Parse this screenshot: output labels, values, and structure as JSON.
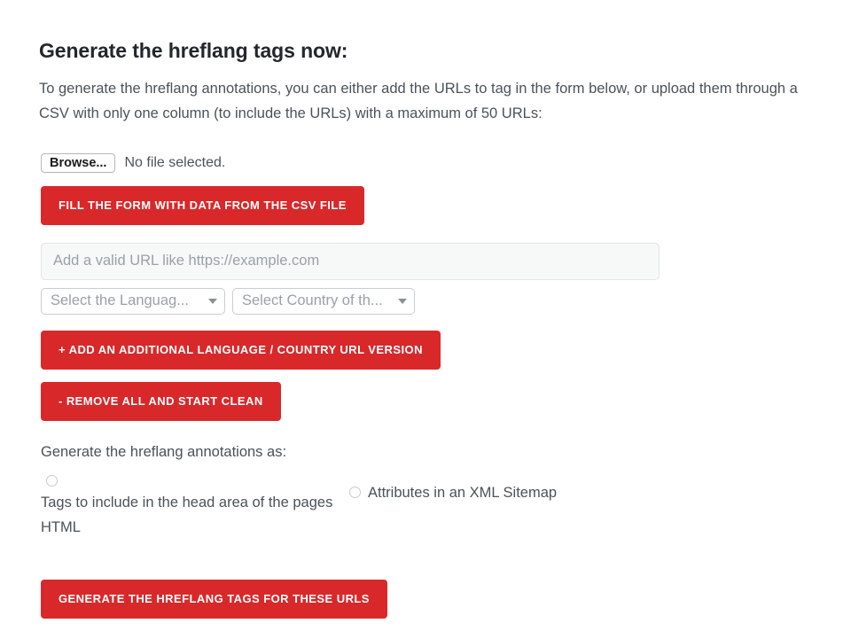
{
  "page": {
    "title": "Generate the hreflang tags now:",
    "intro": "To generate the hreflang annotations, you can either add the URLs to tag in the form below, or upload them through a CSV with only one column (to include the URLs) with a maximum of 50 URLs:",
    "accent_color": "#d8282a",
    "text_color": "#4b525a",
    "heading_color": "#23272c",
    "background": "#ffffff"
  },
  "file_upload": {
    "browse_label": "Browse...",
    "status_text": "No file selected.",
    "fill_form_button": "FILL THE FORM WITH DATA FROM THE CSV FILE"
  },
  "url_entry": {
    "url_placeholder": "Add a valid URL like https://example.com",
    "url_value": "",
    "language_select": {
      "selected": "Select the Languag...",
      "caret_icon": "chevron-down-icon"
    },
    "country_select": {
      "selected": "Select Country of th...",
      "caret_icon": "chevron-down-icon"
    }
  },
  "actions": {
    "add_version_button": "+ ADD AN ADDITIONAL LANGUAGE / COUNTRY URL VERSION",
    "remove_all_button": "- REMOVE ALL AND START CLEAN",
    "generate_button": "GENERATE THE HREFLANG TAGS FOR THESE URLS"
  },
  "output_format": {
    "heading": "Generate the hreflang annotations as:",
    "options": [
      {
        "label": "Tags to include in the head area of the pages HTML",
        "selected": false
      },
      {
        "label": "Attributes in an XML Sitemap",
        "selected": false
      }
    ]
  }
}
